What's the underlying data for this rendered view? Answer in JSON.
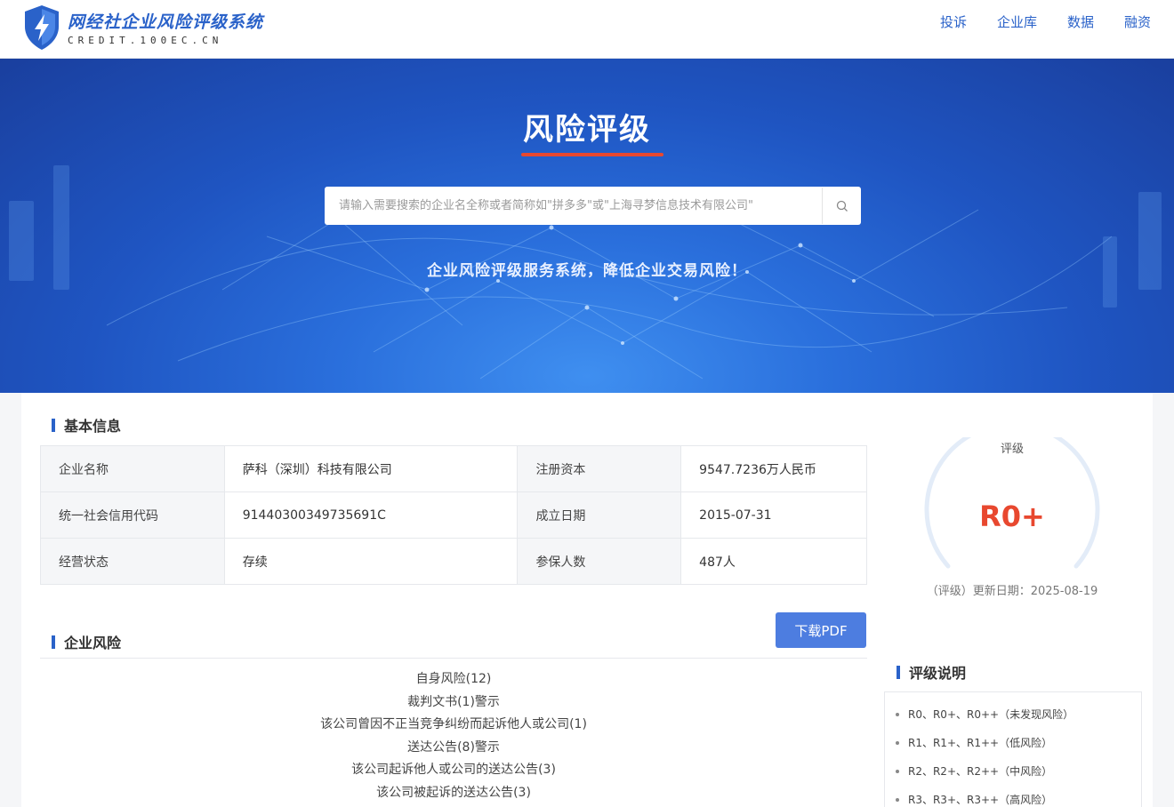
{
  "header": {
    "logo_title": "网经社企业风险评级系统",
    "logo_sub": "CREDIT.100EC.CN",
    "nav": [
      "投诉",
      "企业库",
      "数据",
      "融资"
    ]
  },
  "banner": {
    "title": "风险评级",
    "search_placeholder": "请输入需要搜索的企业名全称或者简称如\"拼多多\"或\"上海寻梦信息技术有限公司\"",
    "slogan": "企业风险评级服务系统，降低企业交易风险！"
  },
  "basic_info": {
    "heading": "基本信息",
    "rows": [
      [
        "企业名称",
        "萨科（深圳）科技有限公司",
        "注册资本",
        "9547.7236万人民币"
      ],
      [
        "统一社会信用代码",
        "91440300349735691C",
        "成立日期",
        "2015-07-31"
      ],
      [
        "经营状态",
        "存续",
        "参保人数",
        "487人"
      ]
    ]
  },
  "rating": {
    "label": "评级",
    "value": "R0+",
    "update": "（评级）更新日期：2025-08-19",
    "accent_color": "#e8482f"
  },
  "risk": {
    "heading": "企业风险",
    "pdf_button": "下载PDF",
    "items": [
      "自身风险(12)",
      "裁判文书(1)警示",
      "该公司曾因不正当竞争纠纷而起诉他人或公司(1)",
      "送达公告(8)警示",
      "该公司起诉他人或公司的送达公告(3)",
      "该公司被起诉的送达公告(3)"
    ]
  },
  "legend": {
    "heading": "评级说明",
    "items": [
      "R0、R0+、R0++（未发现风险）",
      "R1、R1+、R1++（低风险）",
      "R2、R2+、R2++（中风险）",
      "R3、R3+、R3++（高风险）"
    ]
  },
  "colors": {
    "brand": "#2a62c9",
    "banner": "#1f55c2",
    "pdf_button": "#4d7de0"
  }
}
